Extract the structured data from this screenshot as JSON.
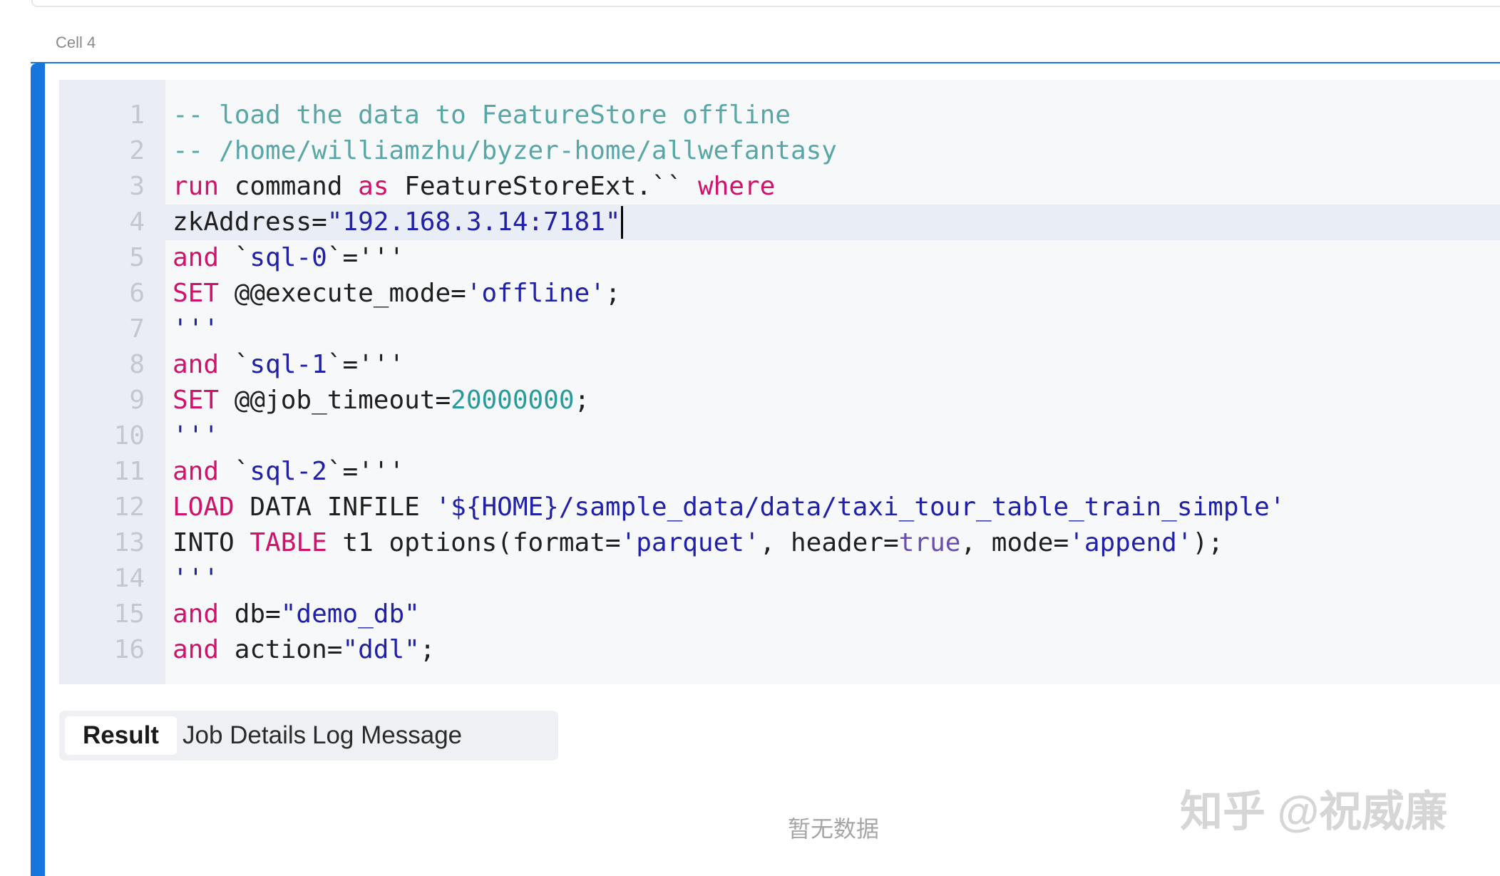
{
  "cell": {
    "label": "Cell 4"
  },
  "editor": {
    "lines": [
      {
        "num": "1",
        "tokens": [
          {
            "t": "comment",
            "v": "-- load the data to FeatureStore offline"
          }
        ]
      },
      {
        "num": "2",
        "tokens": [
          {
            "t": "comment",
            "v": "-- /home/williamzhu/byzer-home/allwefantasy"
          }
        ]
      },
      {
        "num": "3",
        "tokens": [
          {
            "t": "kw",
            "v": "run"
          },
          {
            "t": "plain",
            "v": " command "
          },
          {
            "t": "kw",
            "v": "as"
          },
          {
            "t": "plain",
            "v": " FeatureStoreExt.`` "
          },
          {
            "t": "kw",
            "v": "where"
          }
        ]
      },
      {
        "num": "4",
        "active": true,
        "tokens": [
          {
            "t": "plain",
            "v": "zkAddress="
          },
          {
            "t": "str",
            "v": "\"192.168.3.14:7181\""
          }
        ]
      },
      {
        "num": "5",
        "tokens": [
          {
            "t": "kw",
            "v": "and"
          },
          {
            "t": "plain",
            "v": " `"
          },
          {
            "t": "str",
            "v": "sql-0"
          },
          {
            "t": "plain",
            "v": "`='''"
          }
        ]
      },
      {
        "num": "6",
        "tokens": [
          {
            "t": "kw",
            "v": "SET"
          },
          {
            "t": "plain",
            "v": " @@execute_mode="
          },
          {
            "t": "str",
            "v": "'offline'"
          },
          {
            "t": "plain",
            "v": ";"
          }
        ]
      },
      {
        "num": "7",
        "tokens": [
          {
            "t": "str",
            "v": "'''"
          }
        ]
      },
      {
        "num": "8",
        "tokens": [
          {
            "t": "kw",
            "v": "and"
          },
          {
            "t": "plain",
            "v": " `"
          },
          {
            "t": "str",
            "v": "sql-1"
          },
          {
            "t": "plain",
            "v": "`='''"
          }
        ]
      },
      {
        "num": "9",
        "tokens": [
          {
            "t": "kw",
            "v": "SET"
          },
          {
            "t": "plain",
            "v": " @@job_timeout="
          },
          {
            "t": "num",
            "v": "20000000"
          },
          {
            "t": "plain",
            "v": ";"
          }
        ]
      },
      {
        "num": "10",
        "tokens": [
          {
            "t": "str",
            "v": "'''"
          }
        ]
      },
      {
        "num": "11",
        "tokens": [
          {
            "t": "kw",
            "v": "and"
          },
          {
            "t": "plain",
            "v": " `"
          },
          {
            "t": "str",
            "v": "sql-2"
          },
          {
            "t": "plain",
            "v": "`='''"
          }
        ]
      },
      {
        "num": "12",
        "tokens": [
          {
            "t": "kw",
            "v": "LOAD"
          },
          {
            "t": "plain",
            "v": " DATA INFILE "
          },
          {
            "t": "str",
            "v": "'${HOME}/sample_data/data/taxi_tour_table_train_simple'"
          }
        ]
      },
      {
        "num": "13",
        "tokens": [
          {
            "t": "plain",
            "v": "INTO "
          },
          {
            "t": "kw",
            "v": "TABLE"
          },
          {
            "t": "plain",
            "v": " t1 options(format="
          },
          {
            "t": "str",
            "v": "'parquet'"
          },
          {
            "t": "plain",
            "v": ", header="
          },
          {
            "t": "bool",
            "v": "true"
          },
          {
            "t": "plain",
            "v": ", mode="
          },
          {
            "t": "str",
            "v": "'append'"
          },
          {
            "t": "plain",
            "v": ");"
          }
        ]
      },
      {
        "num": "14",
        "tokens": [
          {
            "t": "str",
            "v": "'''"
          }
        ]
      },
      {
        "num": "15",
        "tokens": [
          {
            "t": "kw",
            "v": "and"
          },
          {
            "t": "plain",
            "v": " db="
          },
          {
            "t": "str",
            "v": "\"demo_db\""
          }
        ]
      },
      {
        "num": "16",
        "tokens": [
          {
            "t": "kw",
            "v": "and"
          },
          {
            "t": "plain",
            "v": " action="
          },
          {
            "t": "str",
            "v": "\"ddl\""
          },
          {
            "t": "plain",
            "v": ";"
          }
        ]
      }
    ]
  },
  "tabs": [
    {
      "label": "Result",
      "active": true
    },
    {
      "label": "Job Details",
      "active": false
    },
    {
      "label": "Log Message",
      "active": false
    }
  ],
  "result": {
    "empty_text": "暂无数据"
  },
  "watermark": {
    "text": "知乎 @祝威廉"
  },
  "colors": {
    "accent": "#1776dc",
    "comment": "#58a6a5",
    "keyword": "#d0126a",
    "string": "#2020a8",
    "number": "#2a9b9b"
  }
}
